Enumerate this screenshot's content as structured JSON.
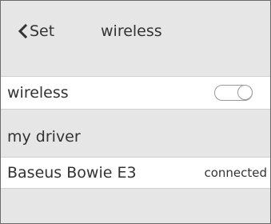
{
  "navbar": {
    "back_label": "Set",
    "title": "wireless"
  },
  "wireless_row": {
    "label": "wireless",
    "toggle_on": false
  },
  "devices_section": {
    "header": "my driver",
    "items": [
      {
        "name": "Baseus Bowie E3",
        "status": "connected"
      }
    ]
  }
}
